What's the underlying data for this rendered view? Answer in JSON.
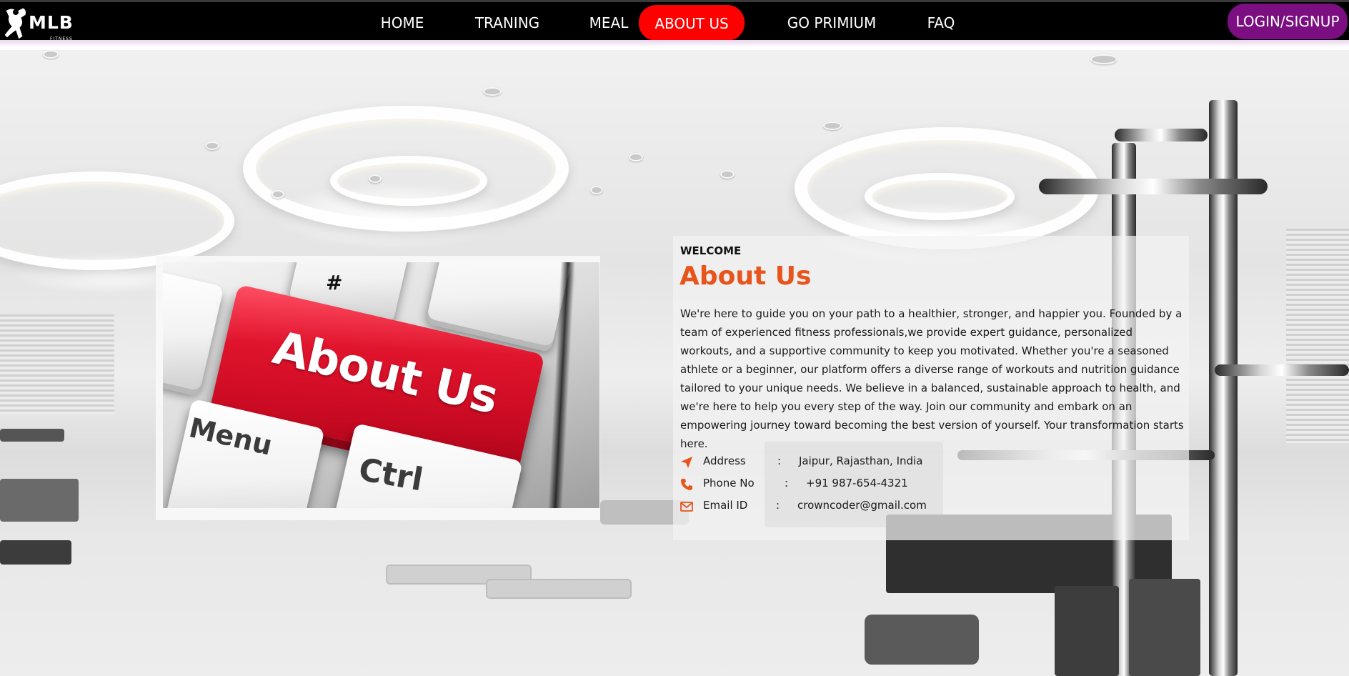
{
  "brand": {
    "logo_text": "MLB",
    "logo_subtext": "FITNESS"
  },
  "nav": {
    "items": [
      {
        "label": "HOME"
      },
      {
        "label": "TRANING"
      },
      {
        "label": "MEAL"
      },
      {
        "label": "ABOUT US",
        "active": true
      },
      {
        "label": "GO PRIMIUM"
      },
      {
        "label": "FAQ"
      }
    ],
    "login_label": "LOGIN/SIGNUP"
  },
  "about_image": {
    "main_key_text": "About Us",
    "key_menu": "Menu",
    "key_ctrl": "Ctrl",
    "key_hash": "#"
  },
  "about": {
    "welcome": "WELCOME",
    "heading": "About Us",
    "paragraph": "We're here to guide you on your path to a healthier, stronger, and happier you. Founded by a team of experienced fitness professionals,we provide expert guidance, personalized workouts, and a supportive community to keep you motivated. Whether you're a seasoned athlete or a beginner, our platform offers a diverse range of workouts and nutrition guidance tailored to your unique needs. We believe in a balanced, sustainable approach to health, and we're here to help you every step of the way. Join our community and embark on an empowering journey toward becoming the best version of yourself. Your transformation starts here.",
    "contacts": [
      {
        "icon": "paper-plane-icon",
        "label": "Address",
        "colon": ":",
        "value": "Jaipur, Rajasthan, India"
      },
      {
        "icon": "phone-icon",
        "label": "Phone No",
        "colon": ":",
        "value": "+91 987-654-4321"
      },
      {
        "icon": "envelope-icon",
        "label": "Email ID",
        "colon": ":",
        "value": "crowncoder@gmail.com"
      }
    ]
  },
  "colors": {
    "nav_bg": "#000000",
    "active_nav": "#ff0000",
    "login_bg": "#7b0f82",
    "accent": "#e8541b"
  }
}
